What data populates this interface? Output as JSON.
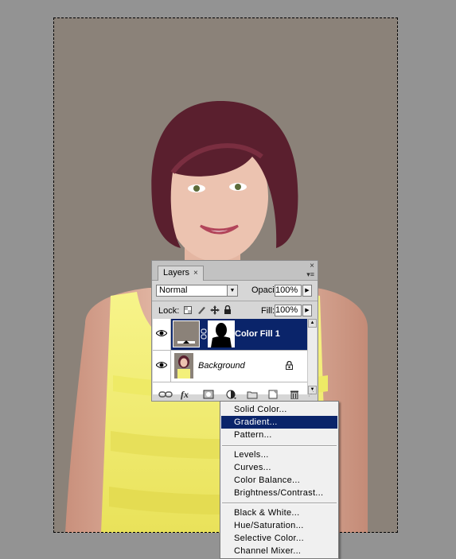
{
  "layers_panel": {
    "tab_label": "Layers",
    "tab_close": "×",
    "close_glyph": "×",
    "menu_glyph": "▾≡",
    "blend_mode": "Normal",
    "opacity_label": "Opacity:",
    "opacity_value": "100%",
    "lock_label": "Lock:",
    "fill_label": "Fill:",
    "fill_value": "100%",
    "layers": [
      {
        "name": "Color Fill 1",
        "selected": true,
        "visible": true
      },
      {
        "name": "Background",
        "selected": false,
        "visible": true,
        "locked": true
      }
    ],
    "footer_icons": [
      "link-icon",
      "fx-icon",
      "mask-icon",
      "adjustment-icon",
      "folder-icon",
      "new-layer-icon",
      "trash-icon"
    ],
    "fx_label": "fx"
  },
  "adjustment_menu": {
    "highlighted": "Gradient...",
    "groups": [
      [
        "Solid Color...",
        "Gradient...",
        "Pattern..."
      ],
      [
        "Levels...",
        "Curves...",
        "Color Balance...",
        "Brightness/Contrast..."
      ],
      [
        "Black & White...",
        "Hue/Saturation...",
        "Selective Color...",
        "Channel Mixer..."
      ]
    ]
  },
  "colors": {
    "workspace": "#939393",
    "fill_layer": "#8b8279",
    "selection_highlight": "#0a246a",
    "dress": "#f3f07a"
  }
}
